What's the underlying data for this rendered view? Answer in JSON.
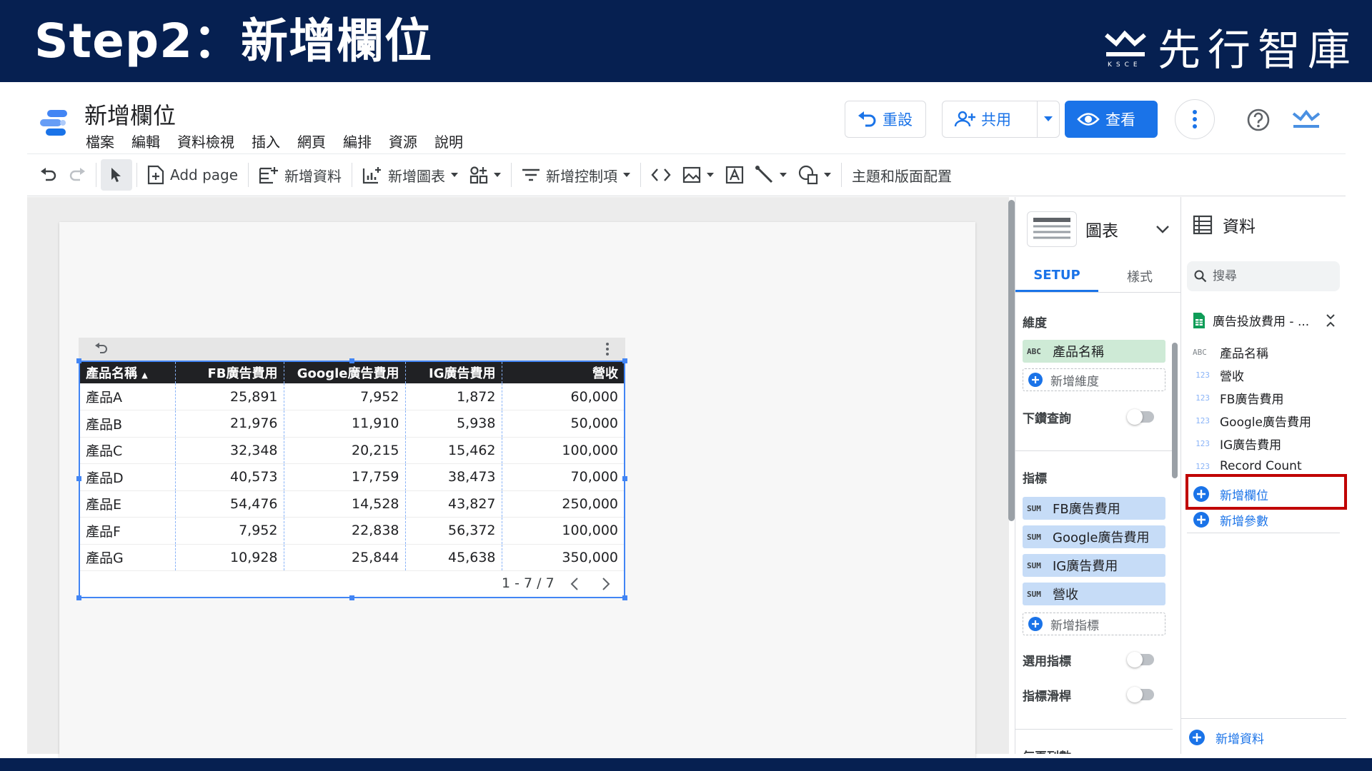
{
  "banner": {
    "title": "Step2：新增欄位",
    "brand_name": "先行智庫",
    "brand_sub": "KSCE"
  },
  "header": {
    "doc_title": "新增欄位",
    "menu": [
      "檔案",
      "編輯",
      "資料檢視",
      "插入",
      "網頁",
      "編排",
      "資源",
      "說明"
    ],
    "reset_label": "重設",
    "share_label": "共用",
    "view_label": "查看"
  },
  "toolbar": {
    "add_page": "Add page",
    "add_data": "新增資料",
    "add_chart": "新增圖表",
    "add_control": "新增控制項",
    "theme_layout": "主題和版面配置"
  },
  "table": {
    "columns": [
      "產品名稱",
      "FB廣告費用",
      "Google廣告費用",
      "IG廣告費用",
      "營收"
    ],
    "sort_indicator": "▲",
    "rows": [
      [
        "產品A",
        "25,891",
        "7,952",
        "1,872",
        "60,000"
      ],
      [
        "產品B",
        "21,976",
        "11,910",
        "5,938",
        "50,000"
      ],
      [
        "產品C",
        "32,348",
        "20,215",
        "15,462",
        "100,000"
      ],
      [
        "產品D",
        "40,573",
        "17,759",
        "38,473",
        "70,000"
      ],
      [
        "產品E",
        "54,476",
        "14,528",
        "43,827",
        "250,000"
      ],
      [
        "產品F",
        "7,952",
        "22,838",
        "56,372",
        "100,000"
      ],
      [
        "產品G",
        "10,928",
        "25,844",
        "45,638",
        "350,000"
      ]
    ],
    "pagination": "1 - 7 / 7"
  },
  "properties": {
    "chart_type": "圖表",
    "tabs": [
      "SETUP",
      "樣式"
    ],
    "dimension_label": "維度",
    "dimension_tag": "ABC",
    "dimension": "產品名稱",
    "add_dimension": "新增維度",
    "drilldown_label": "下鑽查詢",
    "metric_label": "指標",
    "metric_tag": "SUM",
    "metrics": [
      "FB廣告費用",
      "Google廣告費用",
      "IG廣告費用",
      "營收"
    ],
    "add_metric": "新增指標",
    "optional_metrics": "選用指標",
    "metric_slider": "指標滑桿",
    "cut_off_label": "每頁列數"
  },
  "data_panel": {
    "title": "資料",
    "search_placeholder": "搜尋",
    "source": "廣告投放費用 - ...",
    "fields": [
      {
        "tag": "ABC",
        "name": "產品名稱"
      },
      {
        "tag": "123",
        "name": "營收"
      },
      {
        "tag": "123",
        "name": "FB廣告費用"
      },
      {
        "tag": "123",
        "name": "Google廣告費用"
      },
      {
        "tag": "123",
        "name": "IG廣告費用"
      },
      {
        "tag": "123",
        "name": "Record Count"
      }
    ],
    "add_field": "新增欄位",
    "add_parameter": "新增參數",
    "add_data": "新增資料"
  },
  "colors": {
    "banner": "#062051",
    "accent": "#1a73e8",
    "highlight": "#c00000",
    "dimension_chip": "#ceead6",
    "metric_chip": "#c6dcf7"
  }
}
